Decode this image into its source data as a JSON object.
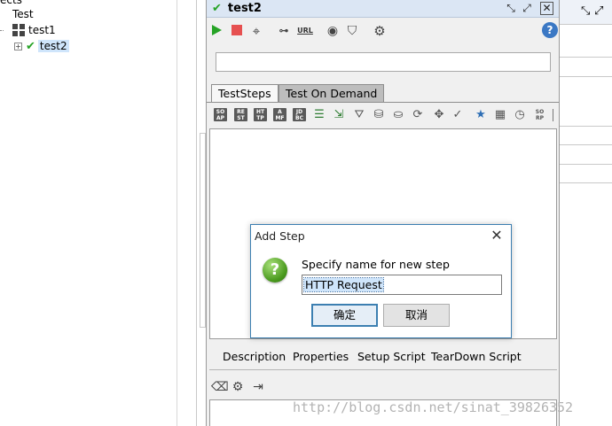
{
  "navigator": {
    "cut_label": "ects",
    "items": [
      {
        "label": "Test"
      },
      {
        "label": "test1"
      },
      {
        "label": "test2"
      }
    ]
  },
  "testcase_window": {
    "title": "test2",
    "toolbar": {
      "url_label": "URL"
    },
    "search": {
      "value": ""
    },
    "tabs": [
      {
        "label": "TestSteps"
      },
      {
        "label": "Test On Demand"
      }
    ],
    "step_icons": [
      "SO AP",
      "RE ST",
      "HT TP",
      "A MF",
      "JD BC"
    ],
    "soap_right_icon": "SO RP",
    "bottom_tabs": [
      {
        "label": "Description"
      },
      {
        "label": "Properties"
      },
      {
        "label": "Setup Script"
      },
      {
        "label": "TearDown Script"
      }
    ]
  },
  "dialog": {
    "title": "Add Step",
    "prompt": "Specify name for new step",
    "input_value": "HTTP Request",
    "ok_label": "确定",
    "cancel_label": "取消"
  },
  "watermark": "http://blog.csdn.net/sinat_39826352",
  "colors": {
    "accent": "#3c7fb1",
    "run_green": "#26a326",
    "stop_red": "#e65050",
    "selection": "#cfe5fb"
  }
}
